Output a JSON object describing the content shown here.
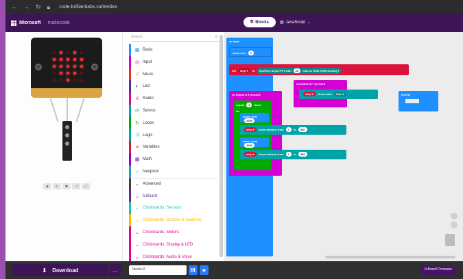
{
  "browser": {
    "url": "code.brilliantlabs.ca/#editor"
  },
  "app": {
    "brand": "Microsoft",
    "project_sub": "makecode",
    "blocks_label": "Blocks",
    "javascript_label": "JavaScript"
  },
  "toolbox": {
    "search_placeholder": "Search...",
    "categories": [
      {
        "label": "Basic",
        "color": "#1e90ff",
        "icon": "▦"
      },
      {
        "label": "Input",
        "color": "#d400d4",
        "icon": "◎"
      },
      {
        "label": "Music",
        "color": "#e63022",
        "icon": "♫"
      },
      {
        "label": "Led",
        "color": "#5c2d91",
        "icon": "◐"
      },
      {
        "label": "Radio",
        "color": "#e3008c",
        "icon": "ıl"
      },
      {
        "label": "Servos",
        "color": "#00a4a6",
        "icon": "⟳"
      },
      {
        "label": "Loops",
        "color": "#00aa00",
        "icon": "↻"
      },
      {
        "label": "Logic",
        "color": "#00a4a6",
        "icon": "⤨"
      },
      {
        "label": "Variables",
        "color": "#dc143c",
        "icon": "≡"
      },
      {
        "label": "Math",
        "color": "#9400d3",
        "icon": "▦"
      },
      {
        "label": "Neopixel",
        "color": "#2699bf",
        "icon": "○"
      },
      {
        "label": "Advanced",
        "color": "#3c3c3c",
        "icon": "⌄"
      },
      {
        "label": "b.Board",
        "color": "#5c2d91",
        "icon": "⌄"
      },
      {
        "label": "Clickboards: Sensors",
        "color": "#1fbcbc",
        "icon": "⌄"
      },
      {
        "label": "Clickboards: Buttons & Switches",
        "color": "#ffb800",
        "icon": "⌄"
      },
      {
        "label": "Clickboards: Motors",
        "color": "#e3008c",
        "icon": "⌄"
      },
      {
        "label": "Clickboards: Display & LED",
        "color": "#e3008c",
        "icon": "⌄"
      },
      {
        "label": "Clickboards: Audio & Voice",
        "color": "#e3008c",
        "icon": "⌄"
      }
    ]
  },
  "blocks": {
    "on_start": "on start",
    "show_icon": "show icon",
    "set": "set",
    "strip": "strip",
    "to": "to",
    "neopixel_at": "NeoPixel at pin P0",
    "with": "with",
    "leds_count": "24",
    "leds_as": "leds as",
    "rgb": "RGB (GRB format)",
    "on_button_b": "on button B",
    "pressed": "pressed",
    "show_color": "show color",
    "blue": "blue",
    "on_button_a": "on button A",
    "repeat": "repeat",
    "repeat_times": "4",
    "times": "times",
    "do": "do",
    "pause_ms": "pause (ms)",
    "pause_val": "1000",
    "show_rainbow": "show rainbow from",
    "rainbow_from": "1",
    "rainbow_to_word": "to",
    "rainbow_to": "360",
    "forever": "forever"
  },
  "bottom": {
    "download_label": "Download",
    "more_label": "...",
    "project_name": "bbetter2",
    "firmware_label": "b.Board Firmware"
  },
  "colors": {
    "header": "#3d1557",
    "download": "#3d1557",
    "neopixel": "#00a4a6",
    "variables": "#dc143c",
    "loops": "#00aa00",
    "input": "#d400d4",
    "basic": "#1e90ff"
  }
}
